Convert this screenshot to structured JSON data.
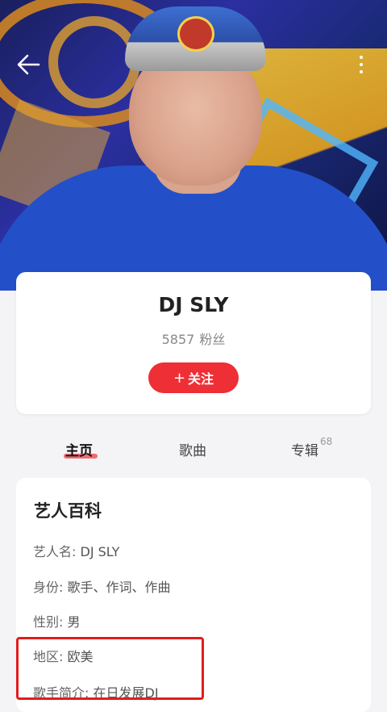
{
  "header": {
    "back_icon": "arrow-left-icon",
    "more_icon": "vertical-dots-icon"
  },
  "profile": {
    "name": "DJ SLY",
    "fans_count": "5857",
    "fans_label": "粉丝",
    "follow_plus": "+",
    "follow_label": "关注",
    "accent_color": "#ee2f35"
  },
  "tabs": {
    "home": "主页",
    "songs": "歌曲",
    "albums": "专辑",
    "albums_count": "68"
  },
  "wiki": {
    "title": "艺人百科",
    "rows": [
      {
        "label": "艺人名:",
        "value": "DJ SLY"
      },
      {
        "label": "身份:",
        "value": "歌手、作词、作曲"
      },
      {
        "label": "性别:",
        "value": "男"
      },
      {
        "label": "地区:",
        "value": "欧美"
      },
      {
        "label": "歌手简介:",
        "value": "在日发展DJ"
      }
    ]
  }
}
